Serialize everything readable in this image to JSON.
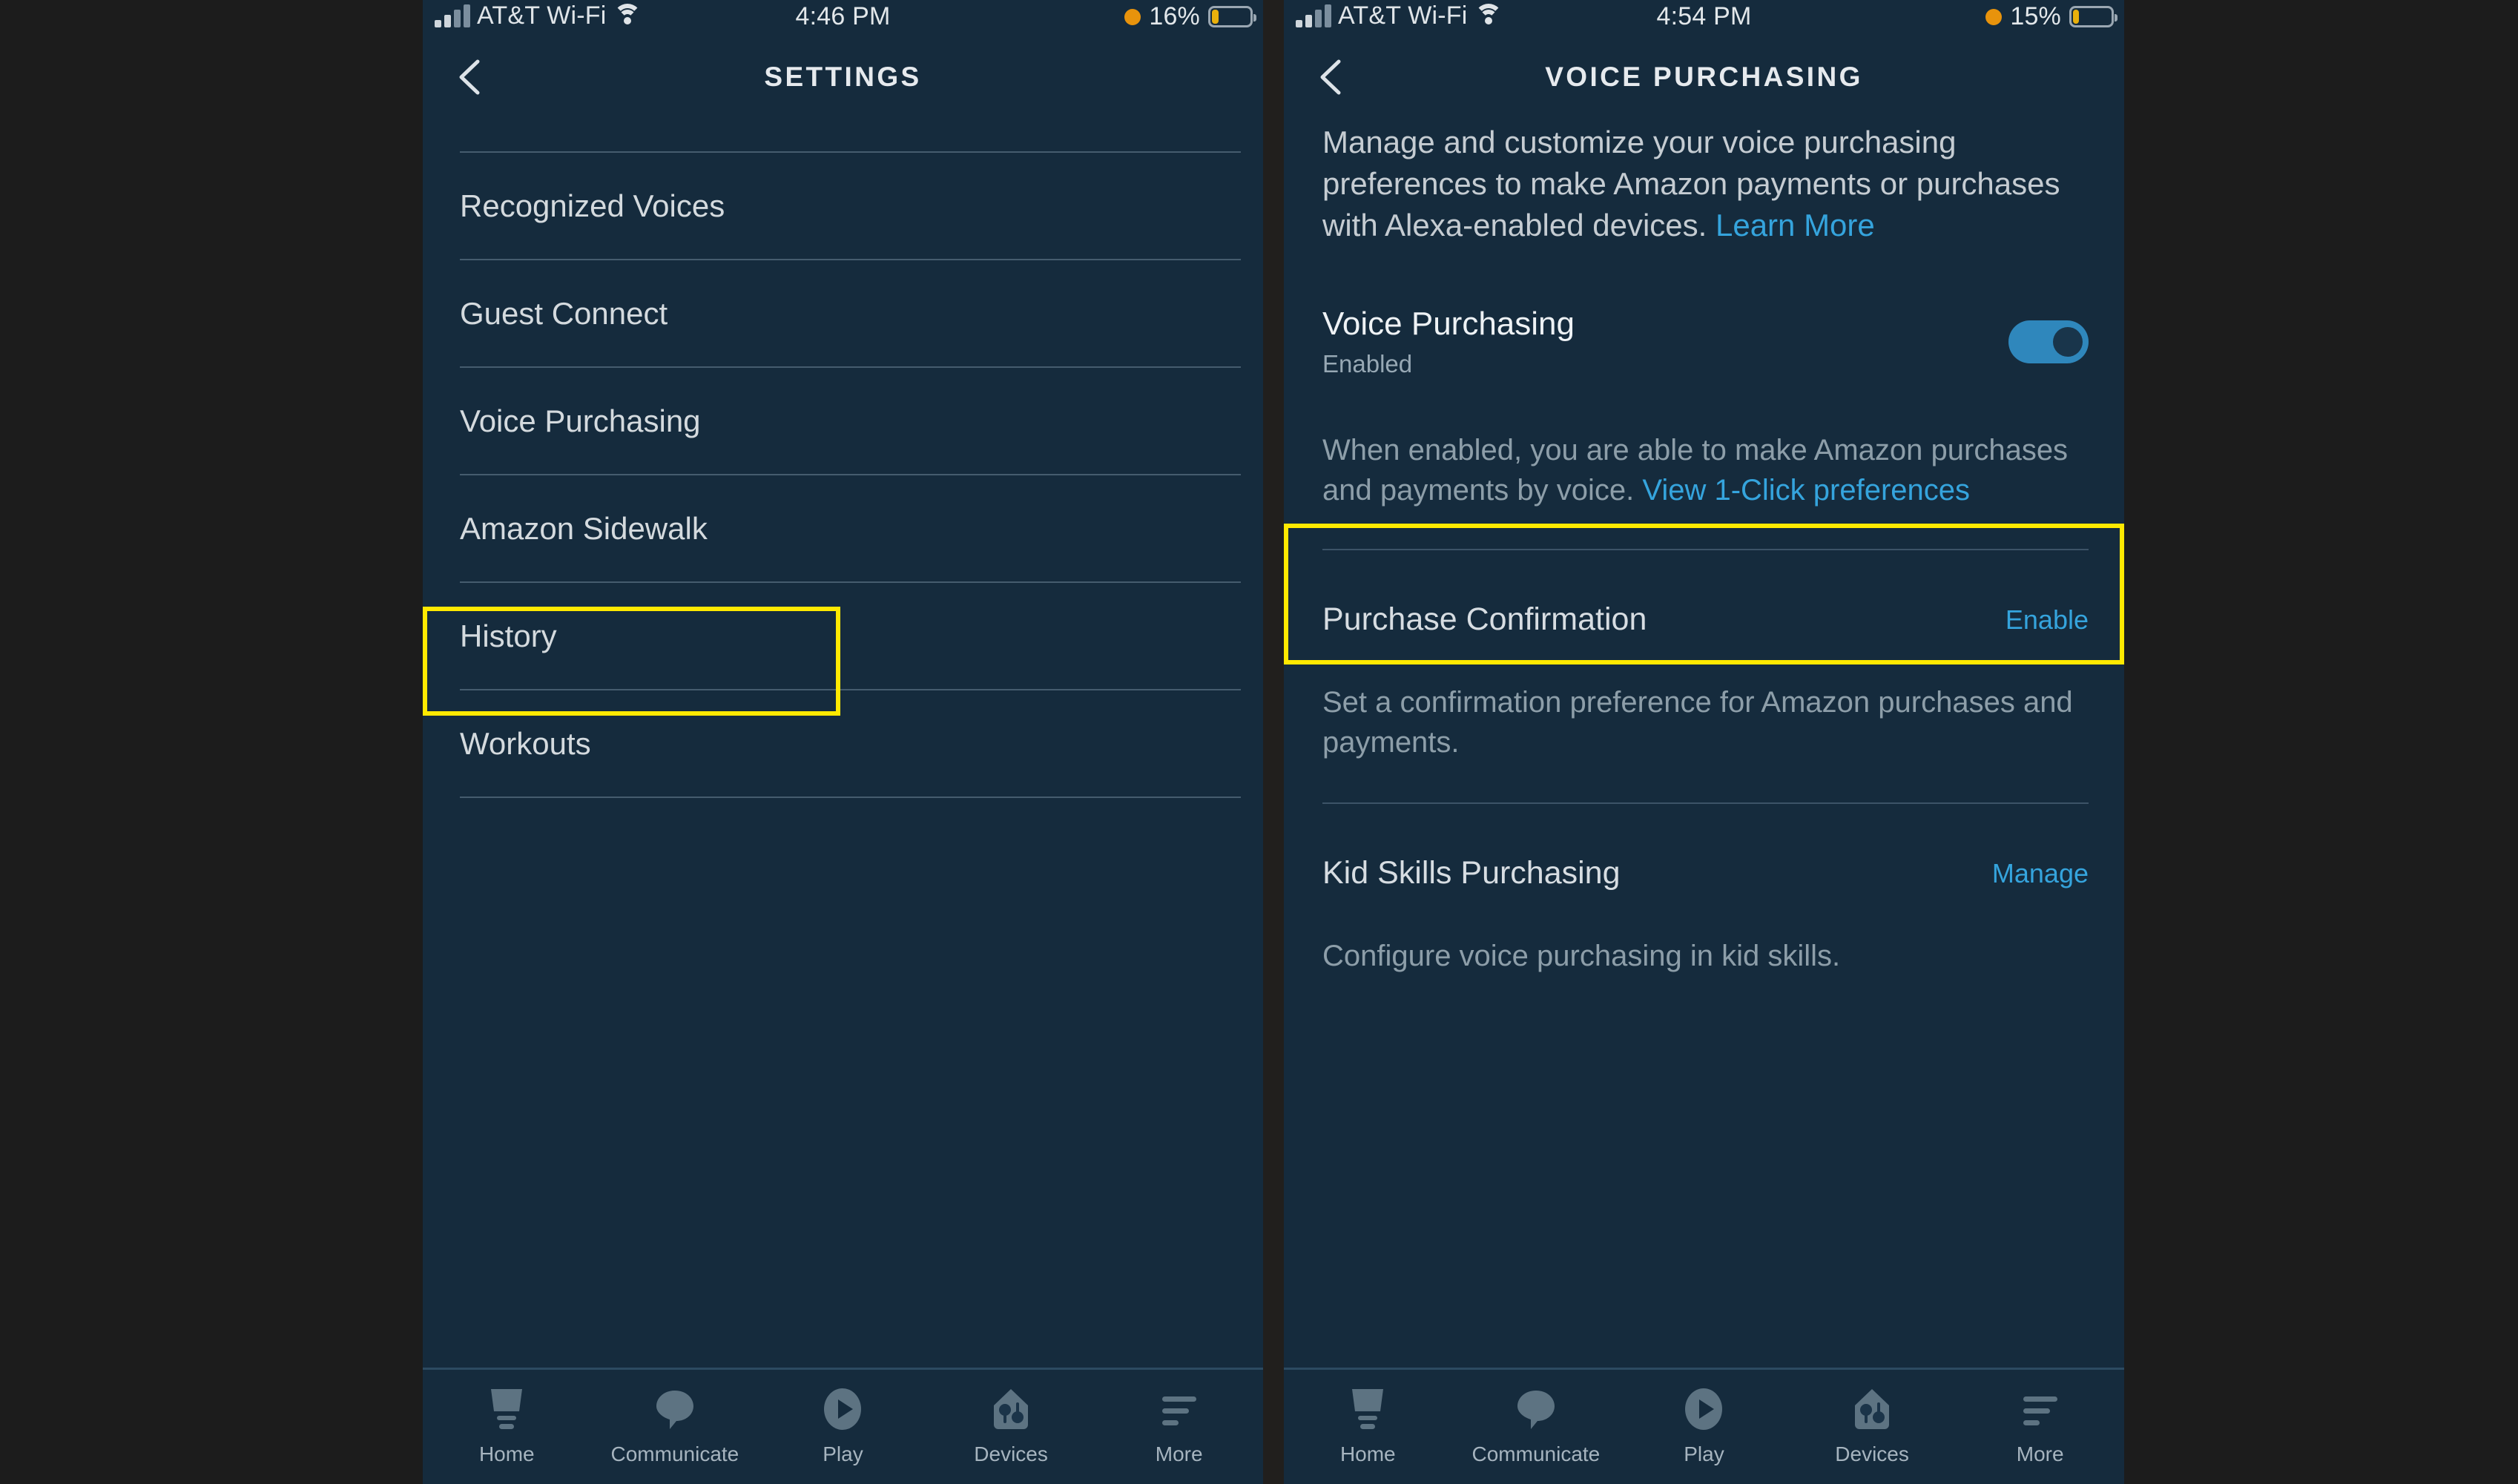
{
  "colors": {
    "page_background": "#1c1c1c",
    "panel_background": "#152B3D",
    "highlight": "#ffe900",
    "link": "#35a4dd",
    "toggle_on": "#2f87bc",
    "primary_text": "#d4dade",
    "secondary_text": "#8d9ea9"
  },
  "left_panel": {
    "status_bar": {
      "signal_icon": "cellular-signal-icon",
      "carrier": "AT&T Wi-Fi",
      "wifi_icon": "wifi-icon",
      "time": "4:46 PM",
      "lowpower_icon": "low-power-dot-icon",
      "battery_percent": "16%",
      "battery_icon": "battery-icon",
      "battery_level": 16
    },
    "nav": {
      "back_icon": "back-chevron-icon",
      "title": "SETTINGS"
    },
    "items": [
      {
        "label": "Recognized Voices",
        "highlighted": false
      },
      {
        "label": "Guest Connect",
        "highlighted": false
      },
      {
        "label": "Voice Purchasing",
        "highlighted": true
      },
      {
        "label": "Amazon Sidewalk",
        "highlighted": false
      },
      {
        "label": "History",
        "highlighted": false
      },
      {
        "label": "Workouts",
        "highlighted": false
      }
    ],
    "tabs": [
      {
        "label": "Home",
        "icon": "home-icon"
      },
      {
        "label": "Communicate",
        "icon": "speech-bubble-icon"
      },
      {
        "label": "Play",
        "icon": "play-circle-icon"
      },
      {
        "label": "Devices",
        "icon": "devices-icon"
      },
      {
        "label": "More",
        "icon": "more-menu-icon"
      }
    ]
  },
  "right_panel": {
    "status_bar": {
      "signal_icon": "cellular-signal-icon",
      "carrier": "AT&T Wi-Fi",
      "wifi_icon": "wifi-icon",
      "time": "4:54 PM",
      "lowpower_icon": "low-power-dot-icon",
      "battery_percent": "15%",
      "battery_icon": "battery-icon",
      "battery_level": 15
    },
    "nav": {
      "back_icon": "back-chevron-icon",
      "title": "VOICE PURCHASING"
    },
    "intro": {
      "text": "Manage and customize your voice purchasing preferences to make Amazon payments or purchases with Alexa-enabled devices. ",
      "link_label": "Learn More"
    },
    "voice_purchasing": {
      "title": "Voice Purchasing",
      "status": "Enabled",
      "toggle_state": "on",
      "highlighted": true
    },
    "voice_purchasing_help": {
      "text": "When enabled, you are able to make Amazon purchases and payments by voice. ",
      "link_label": "View 1-Click preferences"
    },
    "purchase_confirmation": {
      "title": "Purchase Confirmation",
      "action_label": "Enable",
      "description": "Set a confirmation preference for Amazon purchases and payments."
    },
    "kid_skills": {
      "title": "Kid Skills Purchasing",
      "action_label": "Manage",
      "description": "Configure voice purchasing in kid skills."
    },
    "tabs": [
      {
        "label": "Home",
        "icon": "home-icon"
      },
      {
        "label": "Communicate",
        "icon": "speech-bubble-icon"
      },
      {
        "label": "Play",
        "icon": "play-circle-icon"
      },
      {
        "label": "Devices",
        "icon": "devices-icon"
      },
      {
        "label": "More",
        "icon": "more-menu-icon"
      }
    ]
  }
}
